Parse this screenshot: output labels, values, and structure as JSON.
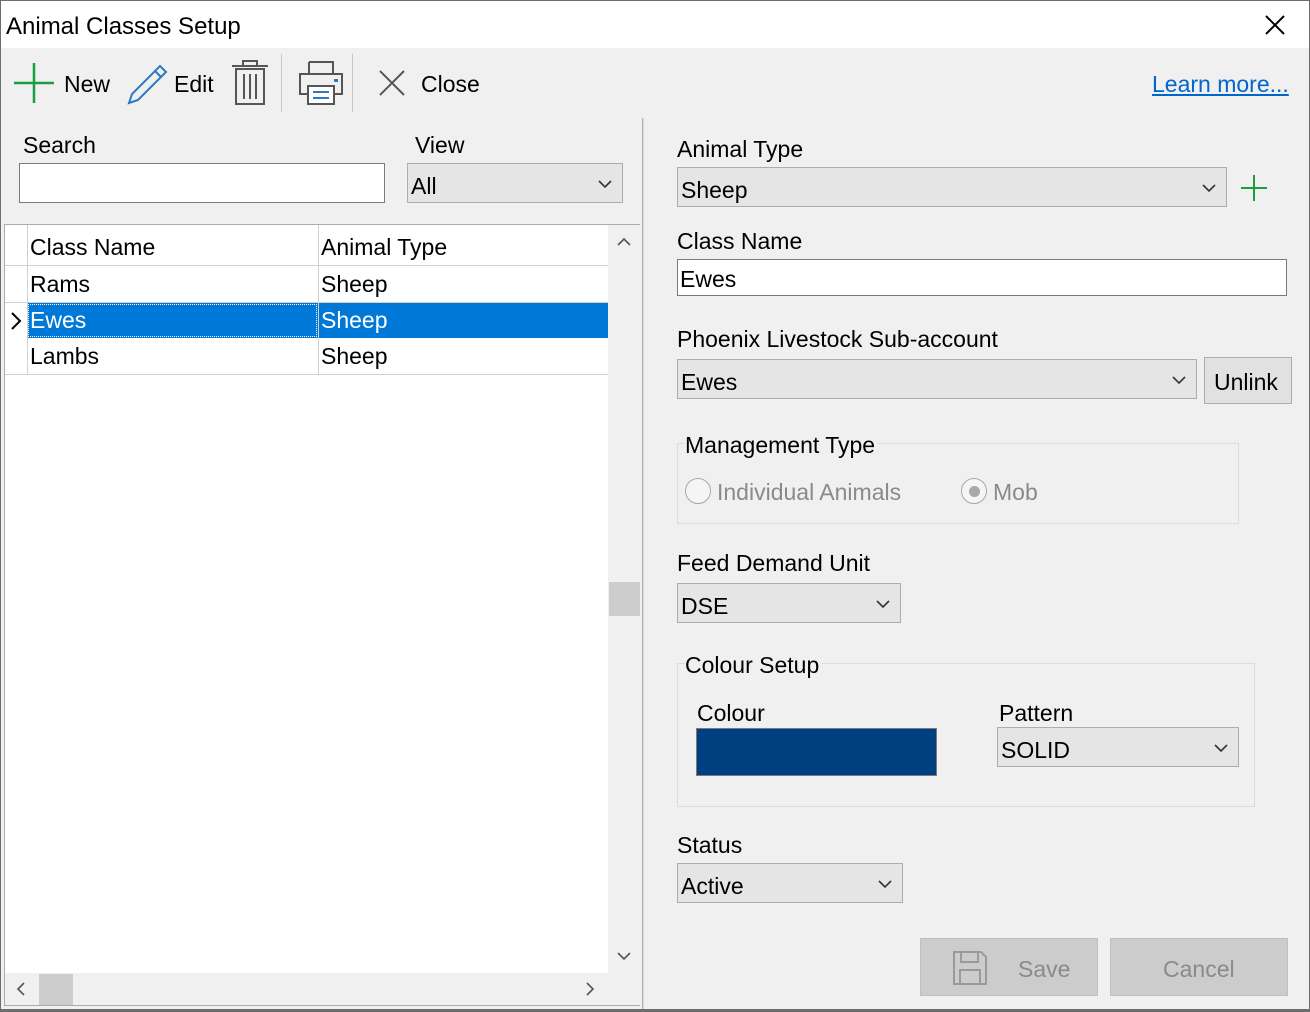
{
  "window": {
    "title": "Animal Classes Setup"
  },
  "toolbar": {
    "new_label": "New",
    "edit_label": "Edit",
    "close_label": "Close",
    "learn_more": "Learn more..."
  },
  "filters": {
    "search_label": "Search",
    "search_value": "",
    "view_label": "View",
    "view_value": "All"
  },
  "grid": {
    "columns": [
      "Class Name",
      "Animal Type"
    ],
    "rows": [
      {
        "class_name": "Rams",
        "animal_type": "Sheep"
      },
      {
        "class_name": "Ewes",
        "animal_type": "Sheep"
      },
      {
        "class_name": "Lambs",
        "animal_type": "Sheep"
      }
    ],
    "selected_index": 1
  },
  "form": {
    "animal_type_label": "Animal Type",
    "animal_type_value": "Sheep",
    "class_name_label": "Class Name",
    "class_name_value": "Ewes",
    "subaccount_label": "Phoenix Livestock Sub-account",
    "subaccount_value": "Ewes",
    "unlink_label": "Unlink",
    "management_label": "Management Type",
    "management_options": [
      "Individual Animals",
      "Mob"
    ],
    "management_selected": "Mob",
    "feed_label": "Feed Demand Unit",
    "feed_value": "DSE",
    "colour_setup_label": "Colour Setup",
    "colour_label": "Colour",
    "colour_value": "#003f7f",
    "pattern_label": "Pattern",
    "pattern_value": "SOLID",
    "status_label": "Status",
    "status_value": "Active",
    "save_label": "Save",
    "cancel_label": "Cancel"
  },
  "colors": {
    "selection": "#0078d7",
    "link": "#0066cc",
    "accent_green": "#1a9e3f"
  },
  "icons": [
    "plus-icon",
    "pencil-icon",
    "trash-icon",
    "printer-icon",
    "close-icon",
    "chevron-down-icon",
    "save-icon",
    "row-indicator-icon"
  ]
}
